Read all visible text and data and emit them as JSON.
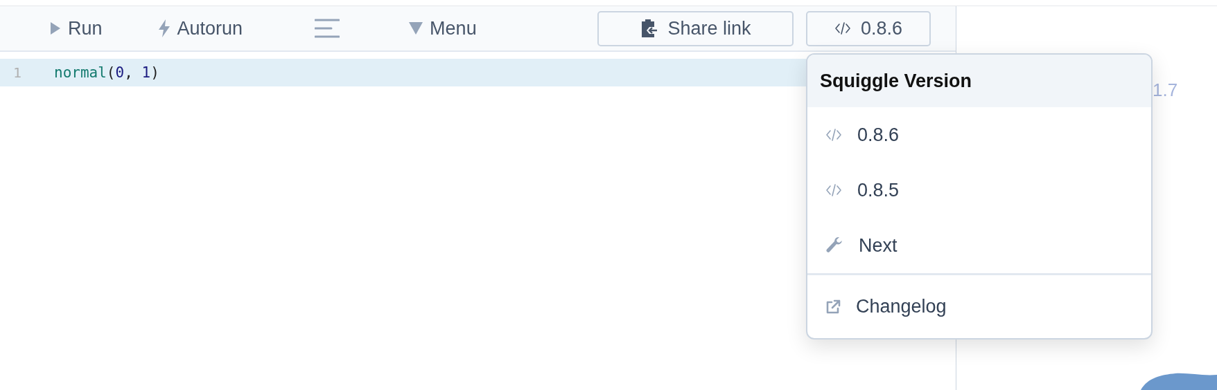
{
  "toolbar": {
    "buttons": [
      {
        "kind": "run",
        "label": "Run"
      },
      {
        "kind": "autorun",
        "label": "Autorun"
      },
      {
        "kind": "format"
      },
      {
        "kind": "menu",
        "label": "Menu"
      }
    ],
    "share_button": "Share link",
    "version_button": "0.8.6"
  },
  "editor": {
    "lines": [
      {
        "number": "1",
        "active": true,
        "tokens": [
          {
            "kind": "function",
            "text": "normal"
          },
          {
            "kind": "punct",
            "text": "("
          },
          {
            "kind": "number",
            "text": "0"
          },
          {
            "kind": "punct",
            "text": ", "
          },
          {
            "kind": "number",
            "text": "1"
          },
          {
            "kind": "punct",
            "text": ")"
          }
        ]
      }
    ]
  },
  "dropdown": {
    "title": "Squiggle Version",
    "items": [
      {
        "kind": "version",
        "label": "0.8.6"
      },
      {
        "kind": "version",
        "label": "0.8.5"
      },
      {
        "kind": "dev",
        "label": "Next"
      },
      {
        "kind": "link",
        "label": "Changelog"
      }
    ]
  },
  "viewer": {
    "partial_text": "1.7"
  }
}
